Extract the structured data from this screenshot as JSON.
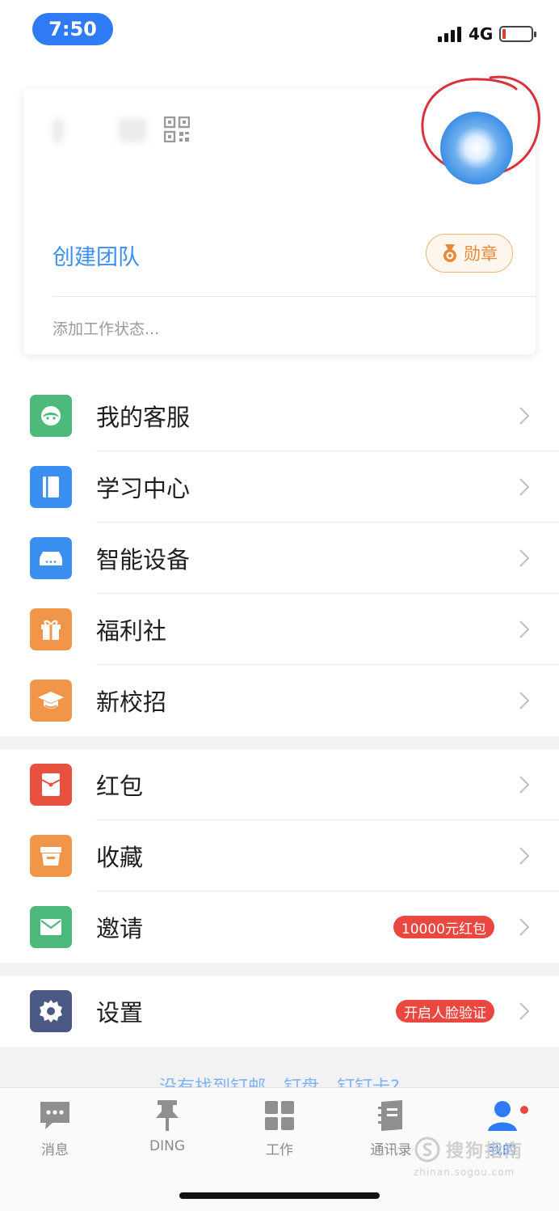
{
  "status_bar": {
    "time": "7:50",
    "network": "4G"
  },
  "profile": {
    "create_team": "创建团队",
    "medal_label": "勋章",
    "work_status_placeholder": "添加工作状态..."
  },
  "menu_groups": [
    [
      {
        "label": "我的客服",
        "icon": "customer-service-icon",
        "color": "#4cb87a"
      },
      {
        "label": "学习中心",
        "icon": "book-icon",
        "color": "#3b8ff0"
      },
      {
        "label": "智能设备",
        "icon": "device-icon",
        "color": "#3b8ff0"
      },
      {
        "label": "福利社",
        "icon": "gift-icon",
        "color": "#f0954a"
      },
      {
        "label": "新校招",
        "icon": "graduation-cap-icon",
        "color": "#f0954a"
      }
    ],
    [
      {
        "label": "红包",
        "icon": "red-envelope-icon",
        "color": "#e8503f"
      },
      {
        "label": "收藏",
        "icon": "favorites-box-icon",
        "color": "#f0954a"
      },
      {
        "label": "邀请",
        "icon": "mail-icon",
        "color": "#4cb87a",
        "badge": "10000元红包"
      }
    ],
    [
      {
        "label": "设置",
        "icon": "settings-icon",
        "color": "#4a5a84",
        "badge": "开启人脸验证"
      }
    ]
  ],
  "promo": "没有找到钉邮、钉盘、钉钉卡?",
  "tabs": [
    {
      "label": "消息",
      "icon": "chat-icon"
    },
    {
      "label": "DING",
      "icon": "pin-icon"
    },
    {
      "label": "工作",
      "icon": "grid-icon"
    },
    {
      "label": "通讯录",
      "icon": "contacts-book-icon"
    },
    {
      "label": "我的",
      "icon": "person-icon",
      "active": true
    }
  ],
  "watermark": {
    "brand": "搜狗指南",
    "url": "zhinan.sogou.com"
  },
  "colors": {
    "accent": "#2f7bf5",
    "badge_red": "#e9473f",
    "medal_orange": "#e8893a"
  }
}
